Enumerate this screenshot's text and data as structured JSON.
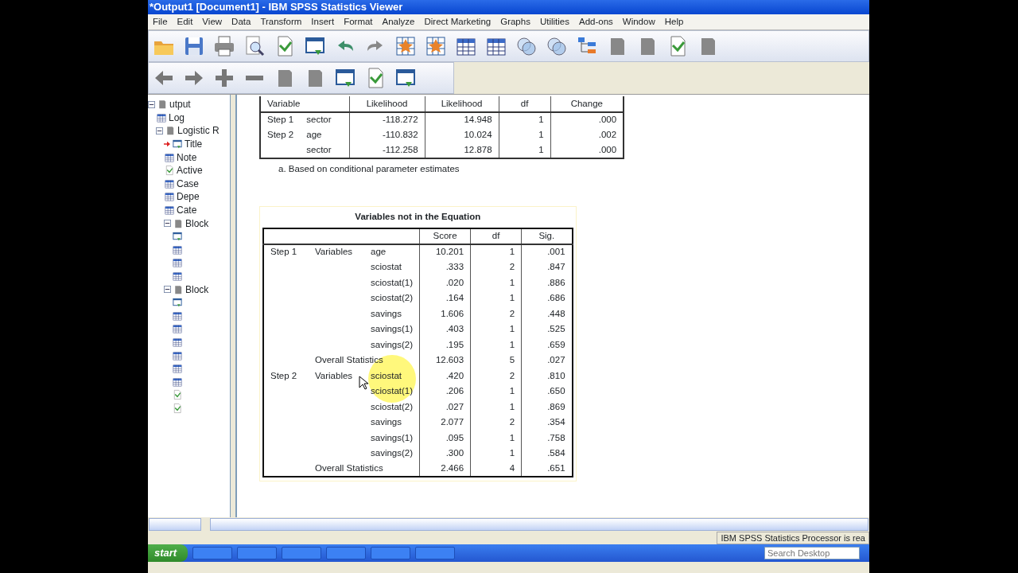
{
  "window": {
    "title": "*Output1 [Document1] - IBM SPSS Statistics Viewer"
  },
  "menu": [
    "File",
    "Edit",
    "View",
    "Data",
    "Transform",
    "Insert",
    "Format",
    "Analyze",
    "Direct Marketing",
    "Graphs",
    "Utilities",
    "Add-ons",
    "Window",
    "Help"
  ],
  "outline": [
    {
      "label": "utput",
      "kind": "root",
      "selected": false,
      "expanded": true,
      "children": [
        {
          "label": "Log",
          "kind": "log",
          "selected": false
        },
        {
          "label": "Logistic R",
          "kind": "section",
          "selected": false,
          "expanded": true,
          "children": [
            {
              "label": "Title",
              "kind": "title",
              "selected": true
            },
            {
              "label": "Note",
              "kind": "table",
              "selected": false
            },
            {
              "label": "Active",
              "kind": "text",
              "selected": false
            },
            {
              "label": "Case",
              "kind": "table",
              "selected": false
            },
            {
              "label": "Depe",
              "kind": "table",
              "selected": false
            },
            {
              "label": "Cate",
              "kind": "table",
              "selected": false
            },
            {
              "label": "Block",
              "kind": "section",
              "selected": false,
              "expanded": true,
              "children": [
                {
                  "kind": "title",
                  "selected": false
                },
                {
                  "kind": "table",
                  "selected": false
                },
                {
                  "kind": "table",
                  "selected": false
                },
                {
                  "kind": "table",
                  "selected": false
                }
              ]
            },
            {
              "label": "Block",
              "kind": "section",
              "selected": false,
              "expanded": true,
              "children": [
                {
                  "kind": "title",
                  "selected": false
                },
                {
                  "kind": "table",
                  "selected": false
                },
                {
                  "kind": "table",
                  "selected": false
                },
                {
                  "kind": "table",
                  "selected": false
                },
                {
                  "kind": "table",
                  "selected": false
                },
                {
                  "kind": "table",
                  "selected": false
                },
                {
                  "kind": "table",
                  "selected": false
                },
                {
                  "kind": "text",
                  "selected": false
                },
                {
                  "kind": "text",
                  "selected": false
                }
              ]
            }
          ]
        }
      ]
    }
  ],
  "model_table": {
    "columns": [
      "Variable",
      "Likelihood",
      "Likelihood",
      "df",
      "Change"
    ],
    "rows": [
      {
        "step": "Step 1",
        "variable": "sector",
        "values": [
          "-118.272",
          "14.948",
          "1",
          ".000"
        ]
      },
      {
        "step": "Step 2",
        "variable": "age",
        "values": [
          "-110.832",
          "10.024",
          "1",
          ".002"
        ]
      },
      {
        "variable": "sector",
        "values": [
          "-112.258",
          "12.878",
          "1",
          ".000"
        ]
      }
    ],
    "footnote": "a. Based on conditional parameter estimates"
  },
  "variables_table": {
    "title": "Variables not in the Equation",
    "columns": [
      "Score",
      "df",
      "Sig."
    ],
    "rows": [
      {
        "kind": "variable",
        "step": "Step 1",
        "group": "Variables",
        "variable": "age",
        "values": [
          "10.201",
          "1",
          ".001"
        ]
      },
      {
        "kind": "variable",
        "variable": "sciostat",
        "values": [
          ".333",
          "2",
          ".847"
        ]
      },
      {
        "kind": "variable",
        "variable": "sciostat(1)",
        "values": [
          ".020",
          "1",
          ".886"
        ]
      },
      {
        "kind": "variable",
        "variable": "sciostat(2)",
        "values": [
          ".164",
          "1",
          ".686"
        ]
      },
      {
        "kind": "variable",
        "variable": "savings",
        "values": [
          "1.606",
          "2",
          ".448"
        ]
      },
      {
        "kind": "variable",
        "variable": "savings(1)",
        "values": [
          ".403",
          "1",
          ".525"
        ]
      },
      {
        "kind": "variable",
        "variable": "savings(2)",
        "values": [
          ".195",
          "1",
          ".659"
        ]
      },
      {
        "kind": "overall",
        "label": "Overall Statistics",
        "values": [
          "12.603",
          "5",
          ".027"
        ]
      },
      {
        "kind": "variable",
        "step": "Step 2",
        "group": "Variables",
        "variable": "sciostat",
        "values": [
          ".420",
          "2",
          ".810"
        ]
      },
      {
        "kind": "variable",
        "variable": "sciostat(1)",
        "values": [
          ".206",
          "1",
          ".650"
        ]
      },
      {
        "kind": "variable",
        "variable": "sciostat(2)",
        "values": [
          ".027",
          "1",
          ".869"
        ]
      },
      {
        "kind": "variable",
        "variable": "savings",
        "values": [
          "2.077",
          "2",
          ".354"
        ]
      },
      {
        "kind": "variable",
        "variable": "savings(1)",
        "values": [
          ".095",
          "1",
          ".758"
        ]
      },
      {
        "kind": "variable",
        "variable": "savings(2)",
        "values": [
          ".300",
          "1",
          ".584"
        ]
      },
      {
        "kind": "overall",
        "label": "Overall Statistics",
        "values": [
          "2.466",
          "4",
          ".651"
        ]
      }
    ]
  },
  "status_bar": {
    "text": "IBM SPSS Statistics Processor is rea"
  },
  "taskbar": {
    "start": "start",
    "search_placeholder": "Search Desktop"
  }
}
